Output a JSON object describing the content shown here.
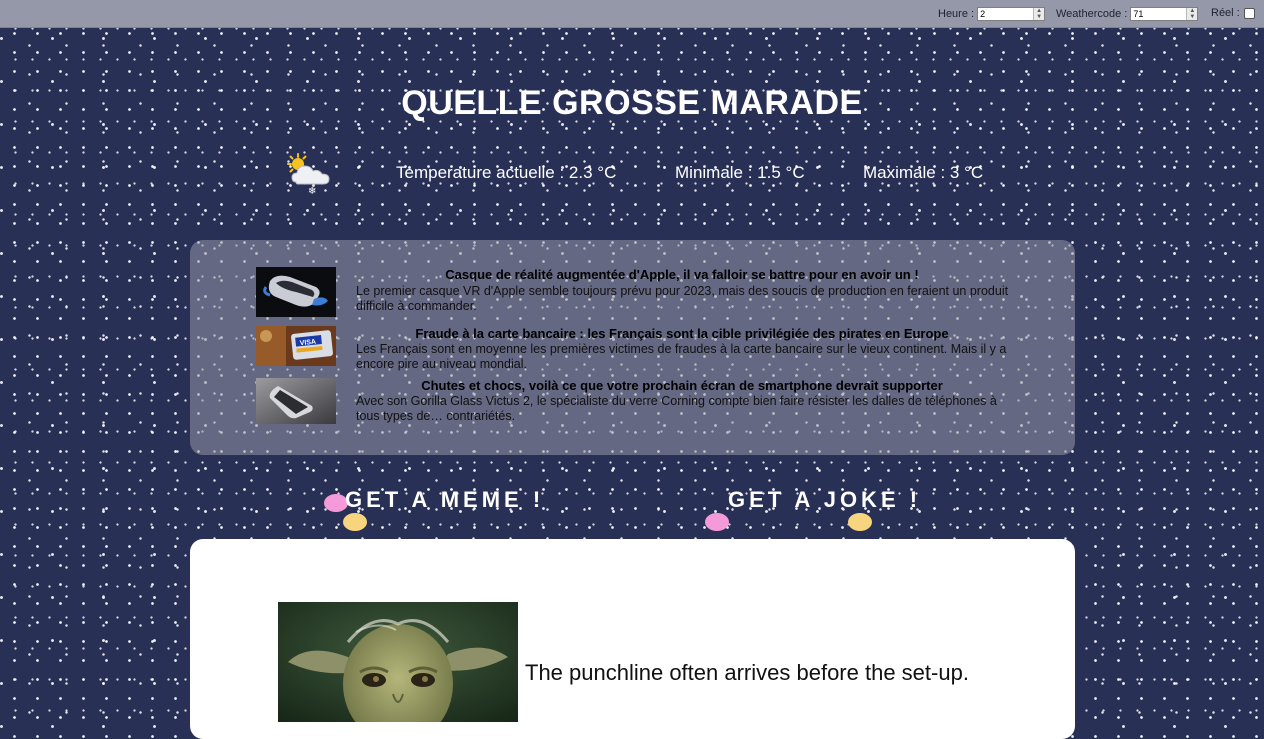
{
  "controls": {
    "hour_label": "Heure :",
    "hour_value": "2",
    "weathercode_label": "Weathercode :",
    "weathercode_value": "71",
    "real_label": "Réel :"
  },
  "header": {
    "title": "QUELLE GROSSE MARADE"
  },
  "weather": {
    "icon": "partly-cloudy-snow-icon",
    "current": "Temperature actuelle : 2.3 °C",
    "min": "Minimale : 1.5 °C",
    "max": "Maximale : 3 °C"
  },
  "news": [
    {
      "title": "Casque de réalité augmentée d'Apple, il va falloir se battre pour en avoir un !",
      "description": "Le premier casque VR d'Apple semble toujours prévu pour 2023, mais des soucis de production en feraient un produit difficile à commander.",
      "thumb_icon": "vr-headset-thumbnail"
    },
    {
      "title": "Fraude à la carte bancaire : les Français sont la cible privilégiée des pirates en Europe",
      "description": "Les Français sont en moyenne les premières victimes de fraudes à la carte bancaire sur le vieux continent. Mais il y a encore pire au niveau mondial.",
      "thumb_icon": "visa-card-thumbnail",
      "thumb_text": "VISA"
    },
    {
      "title": "Chutes et chocs, voilà ce que votre prochain écran de smartphone devrait supporter",
      "description": "Avec son Gorilla Glass Victus 2, le spécialiste du verre Corning compte bien faire résister les dalles de téléphones à tous types de… contrariétés.",
      "thumb_icon": "smartphone-thumbnail"
    }
  ],
  "actions": {
    "meme_label": "GET A MEME !",
    "joke_label": "GET A JOKE !"
  },
  "meme": {
    "image_icon": "yoda-meme-image",
    "caption": "The punchline often arrives before the set-up."
  },
  "colors": {
    "background": "#283056",
    "topbar": "#9498a8",
    "blob_pink": "#f49ad8",
    "blob_yellow": "#f6d57e"
  }
}
